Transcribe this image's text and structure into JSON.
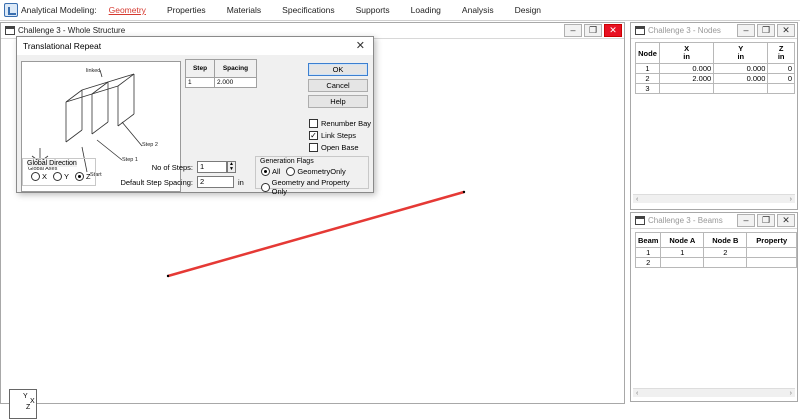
{
  "ribbon": {
    "app_label": "Analytical Modeling:",
    "tabs": [
      "Geometry",
      "Properties",
      "Materials",
      "Specifications",
      "Supports",
      "Loading",
      "Analysis",
      "Design"
    ],
    "active_tab": "Geometry",
    "active_color": "#d6392f"
  },
  "main_window": {
    "title": "Challenge 3 - Whole Structure",
    "beam_color": "#e53935"
  },
  "dialog": {
    "title": "Translational Repeat",
    "preview_labels": {
      "linked": "linked",
      "step2": "Step 2",
      "step1": "Step 1",
      "start": "Start",
      "global_axes": "Global Axes"
    },
    "step_table": {
      "headers": [
        "Step",
        "Spacing"
      ],
      "rows": [
        [
          "1",
          "2.000"
        ]
      ]
    },
    "buttons": {
      "ok": "OK",
      "cancel": "Cancel",
      "help": "Help"
    },
    "checks": [
      {
        "label": "Renumber Bay",
        "checked": false
      },
      {
        "label": "Link Steps",
        "checked": true
      },
      {
        "label": "Open Base",
        "checked": false
      }
    ],
    "global_direction": {
      "label": "Global Direction",
      "options": [
        "X",
        "Y",
        "Z"
      ],
      "selected": "Z"
    },
    "no_of_steps": {
      "label": "No of Steps:",
      "value": "1"
    },
    "default_spacing": {
      "label": "Default Step Spacing:",
      "value": "2",
      "unit": "in"
    },
    "generation_flags": {
      "label": "Generation Flags",
      "options": [
        "All",
        "GeometryOnly",
        "Geometry and Property Only"
      ],
      "selected": "All"
    }
  },
  "view": {
    "axis_labels": {
      "y": "Y",
      "x": "X",
      "z": "Z"
    }
  },
  "nodes_panel": {
    "title": "Challenge 3 - Nodes",
    "headers": [
      [
        "Node",
        ""
      ],
      [
        "X",
        "in"
      ],
      [
        "Y",
        "in"
      ],
      [
        "Z",
        "in"
      ]
    ],
    "rows": [
      [
        "1",
        "0.000",
        "0.000",
        "0"
      ],
      [
        "2",
        "2.000",
        "0.000",
        "0"
      ],
      [
        "3",
        "",
        "",
        ""
      ]
    ]
  },
  "beams_panel": {
    "title": "Challenge 3 - Beams",
    "headers": [
      "Beam",
      "Node A",
      "Node B",
      "Property"
    ],
    "rows": [
      [
        "1",
        "1",
        "2",
        ""
      ],
      [
        "2",
        "",
        "",
        ""
      ]
    ]
  }
}
